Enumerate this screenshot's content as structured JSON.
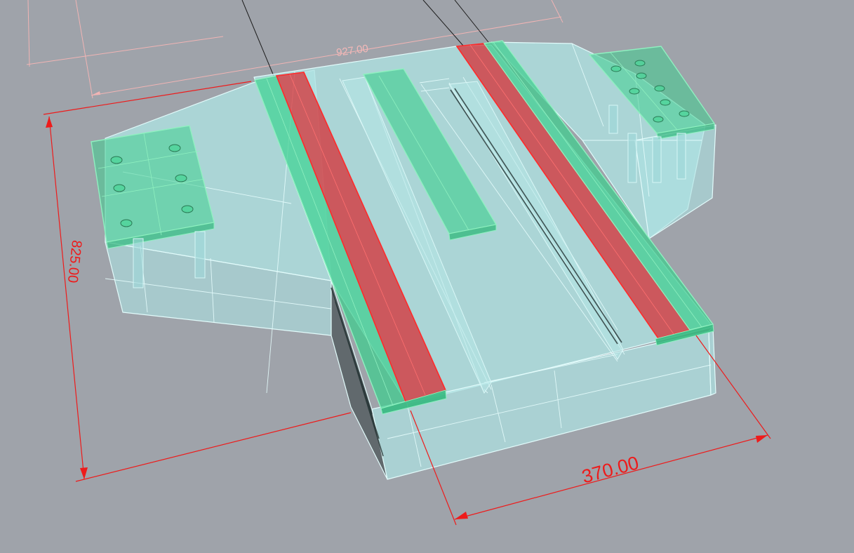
{
  "viewport": {
    "background": "#9fa3aa",
    "colors": {
      "body_fill": "#aee3e3",
      "body_edge": "#dff9f9",
      "rail_green": "#3fcf8f",
      "rail_red": "#e0282e",
      "dimension": "#ee1b1b"
    }
  },
  "dimensions": {
    "top": "927.00",
    "left": "825.00",
    "bottom": "370.00"
  }
}
